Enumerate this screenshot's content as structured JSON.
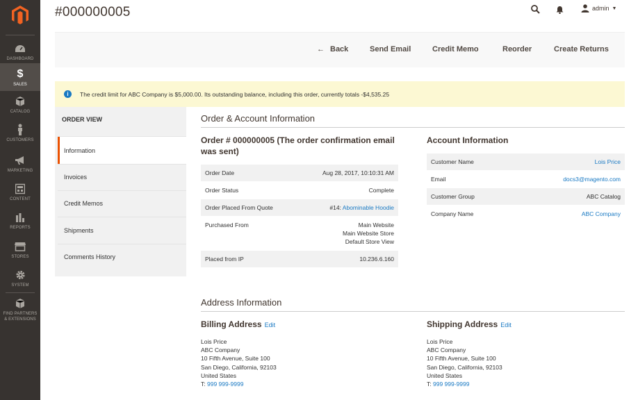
{
  "sidebar": {
    "items": [
      {
        "label": "Dashboard",
        "icon": "dashboard-icon"
      },
      {
        "label": "Sales",
        "icon": "dollar-icon"
      },
      {
        "label": "Catalog",
        "icon": "box-icon"
      },
      {
        "label": "Customers",
        "icon": "person-icon"
      },
      {
        "label": "Marketing",
        "icon": "megaphone-icon"
      },
      {
        "label": "Content",
        "icon": "layout-icon"
      },
      {
        "label": "Reports",
        "icon": "bar-chart-icon"
      },
      {
        "label": "Stores",
        "icon": "store-icon"
      },
      {
        "label": "System",
        "icon": "gear-icon"
      },
      {
        "label": "Find Partners",
        "icon": "extensions-icon"
      },
      {
        "label": "& Extensions",
        "icon": ""
      }
    ]
  },
  "header": {
    "title": "#000000005",
    "user": "admin"
  },
  "actions": {
    "back": "Back",
    "send_email": "Send Email",
    "credit_memo": "Credit Memo",
    "reorder": "Reorder",
    "create_returns": "Create Returns"
  },
  "message": {
    "text": "The credit limit for ABC Company is $5,000.00. Its outstanding balance, including this order, currently totals -$4,535.25"
  },
  "tabs": {
    "title": "Order View",
    "items": [
      "Information",
      "Invoices",
      "Credit Memos",
      "Shipments",
      "Comments History"
    ]
  },
  "order_account": {
    "section_title": "Order & Account Information",
    "order_title": "Order # 000000005 (The order confirmation email was sent)",
    "order_rows": [
      {
        "label": "Order Date",
        "value": "Aug 28, 2017, 10:10:31 AM"
      },
      {
        "label": "Order Status",
        "value": "Complete"
      },
      {
        "label": "Order Placed From Quote",
        "prefix": "#14: ",
        "value": "Abominable Hoodie"
      },
      {
        "label": "Purchased From",
        "lines": [
          "Main Website",
          "Main Website Store",
          "Default Store View"
        ]
      },
      {
        "label": "Placed from IP",
        "value": "10.236.6.160"
      }
    ],
    "account_title": "Account Information",
    "account_rows": [
      {
        "label": "Customer Name",
        "value": "Lois Price"
      },
      {
        "label": "Email",
        "value": "docs3@magento.com"
      },
      {
        "label": "Customer Group",
        "value": "ABC Catalog"
      },
      {
        "label": "Company Name",
        "value": "ABC Company"
      }
    ]
  },
  "address": {
    "section_title": "Address Information",
    "edit_label": "Edit",
    "billing": {
      "title": "Billing Address",
      "lines": [
        "Lois Price",
        "ABC Company",
        "10 Fifth Avenue, Suite 100",
        "San Diego, California, 92103",
        "United States"
      ],
      "phone_prefix": "T: ",
      "phone": "999 999-9999"
    },
    "shipping": {
      "title": "Shipping Address",
      "lines": [
        "Lois Price",
        "ABC Company",
        "10 Fifth Avenue, Suite 100",
        "San Diego, California, 92103",
        "United States"
      ],
      "phone_prefix": "T: ",
      "phone": "999 999-9999"
    }
  },
  "colors": {
    "accent": "#eb5202",
    "link": "#1979c3",
    "sidebar": "#373330",
    "notice": "#fcf8d3"
  }
}
